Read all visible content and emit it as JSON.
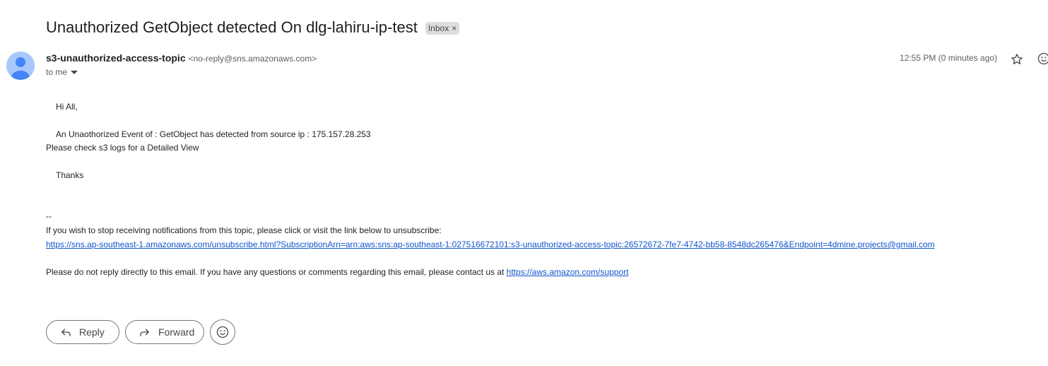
{
  "email": {
    "subject": "Unauthorized GetObject detected On dlg-lahiru-ip-test",
    "label": "Inbox",
    "label_remove": "×",
    "sender": {
      "name": "s3-unauthorized-access-topic",
      "email": "<no-reply@sns.amazonaws.com>"
    },
    "to": "to me",
    "time": "12:55 PM (0 minutes ago)",
    "body": {
      "greeting": "Hi All,",
      "event_line": "An Unaothorized Event of : GetObject has detected from source ip  :  175.157.28.253",
      "check_line": "Please check s3 logs for a Detailed View",
      "thanks": "Thanks",
      "separator": "--",
      "unsubscribe_intro": "If you wish to stop receiving notifications from this topic, please click or visit the link below to unsubscribe:",
      "unsubscribe_link": "https://sns.ap-southeast-1.amazonaws.com/unsubscribe.html?SubscriptionArn=arn:aws:sns:ap-southeast-1:027516672101:s3-unauthorized-access-topic:26572672-7fe7-4742-bb58-8548dc265476&Endpoint=4dmine.projects@gmail.com",
      "footer_text": "Please do not reply directly to this email. If you have any questions or comments regarding this email, please contact us at ",
      "support_link": "https://aws.amazon.com/support"
    }
  },
  "actions": {
    "reply": "Reply",
    "forward": "Forward"
  },
  "colors": {
    "link": "#1155cc",
    "avatar_bg": "#a8c7fa",
    "avatar_fg": "#4285f4",
    "label_bg": "#dddddd"
  }
}
